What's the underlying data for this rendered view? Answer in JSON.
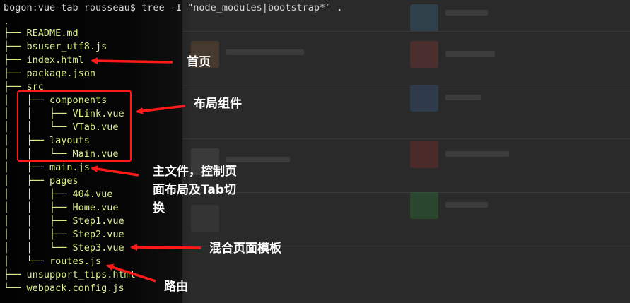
{
  "terminal": {
    "prompt_line": "bogon:vue-tab rousseau$ tree -I \"node_modules|bootstrap*\" .",
    "lines": [
      ".",
      "├── README.md",
      "├── bsuser_utf8.js",
      "├── index.html",
      "├── package.json",
      "├── src",
      "│   ├── components",
      "│   │   ├── VLink.vue",
      "│   │   └── VTab.vue",
      "│   ├── layouts",
      "│   │   └── Main.vue",
      "│   ├── main.js",
      "│   ├── pages",
      "│   │   ├── 404.vue",
      "│   │   ├── Home.vue",
      "│   │   ├── Step1.vue",
      "│   │   ├── Step2.vue",
      "│   │   └── Step3.vue",
      "│   └── routes.js",
      "├── unsupport_tips.html",
      "└── webpack.config.js"
    ]
  },
  "annotations": {
    "home": "首页",
    "layout_components": "布局组件",
    "main_file": "主文件，控制页\n面布局及Tab切\n换",
    "mixed_templates": "混合页面模板",
    "routes": "路由"
  },
  "colors": {
    "terminal_text": "#d9f08c",
    "prompt_text": "#d8d8d8",
    "annotation_red": "#ff1a1a",
    "annotation_label": "#ffffff",
    "background": "#050505"
  }
}
